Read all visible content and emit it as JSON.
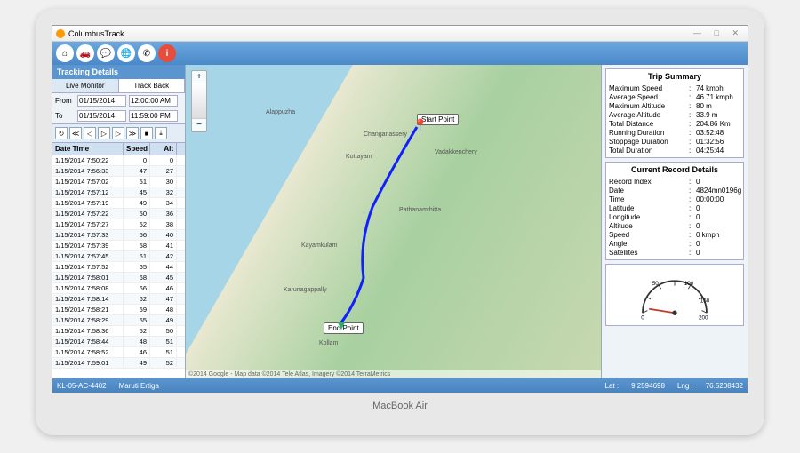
{
  "window": {
    "title": "ColumbusTrack"
  },
  "toolbar_icons": [
    "home-icon",
    "car-icon",
    "chat-icon",
    "globe-icon",
    "phone-icon",
    "info-icon"
  ],
  "left": {
    "header": "Tracking Details",
    "tabs": [
      "Live Monitor",
      "Track Back"
    ],
    "from_label": "From",
    "to_label": "To",
    "from_date": "01/15/2014",
    "from_time": "12:00:00 AM",
    "to_date": "01/15/2014",
    "to_time": "11:59:00 PM",
    "columns": [
      "Date Time",
      "Speed",
      "Alt"
    ],
    "rows": [
      {
        "dt": "1/15/2014 7:50:22",
        "sp": "0",
        "al": "0"
      },
      {
        "dt": "1/15/2014 7:56:33",
        "sp": "47",
        "al": "27"
      },
      {
        "dt": "1/15/2014 7:57:02",
        "sp": "51",
        "al": "30"
      },
      {
        "dt": "1/15/2014 7:57:12",
        "sp": "45",
        "al": "32"
      },
      {
        "dt": "1/15/2014 7:57:19",
        "sp": "49",
        "al": "34"
      },
      {
        "dt": "1/15/2014 7:57:22",
        "sp": "50",
        "al": "36"
      },
      {
        "dt": "1/15/2014 7:57:27",
        "sp": "52",
        "al": "38"
      },
      {
        "dt": "1/15/2014 7:57:33",
        "sp": "56",
        "al": "40"
      },
      {
        "dt": "1/15/2014 7:57:39",
        "sp": "58",
        "al": "41"
      },
      {
        "dt": "1/15/2014 7:57:45",
        "sp": "61",
        "al": "42"
      },
      {
        "dt": "1/15/2014 7:57:52",
        "sp": "65",
        "al": "44"
      },
      {
        "dt": "1/15/2014 7:58:01",
        "sp": "68",
        "al": "45"
      },
      {
        "dt": "1/15/2014 7:58:08",
        "sp": "66",
        "al": "46"
      },
      {
        "dt": "1/15/2014 7:58:14",
        "sp": "62",
        "al": "47"
      },
      {
        "dt": "1/15/2014 7:58:21",
        "sp": "59",
        "al": "48"
      },
      {
        "dt": "1/15/2014 7:58:29",
        "sp": "55",
        "al": "49"
      },
      {
        "dt": "1/15/2014 7:58:36",
        "sp": "52",
        "al": "50"
      },
      {
        "dt": "1/15/2014 7:58:44",
        "sp": "48",
        "al": "51"
      },
      {
        "dt": "1/15/2014 7:58:52",
        "sp": "46",
        "al": "51"
      },
      {
        "dt": "1/15/2014 7:59:01",
        "sp": "49",
        "al": "52"
      }
    ]
  },
  "map": {
    "start_label": "Start Point",
    "end_label": "End Point",
    "cities": [
      "Alappuzha",
      "Kottayam",
      "Changanassery",
      "Pathanamthitta",
      "Kollam",
      "Karunagappally",
      "Kayamkulam",
      "Vadakkenchery"
    ],
    "attribution": "©2014 Google - Map data ©2014 Tele Atlas, Imagery ©2014 TerraMetrics"
  },
  "summary": {
    "title": "Trip Summary",
    "rows": [
      {
        "k": "Maximum Speed",
        "v": "74 kmph"
      },
      {
        "k": "Average Speed",
        "v": "46.71 kmph"
      },
      {
        "k": "Maximum Altitude",
        "v": "80 m"
      },
      {
        "k": "Average Altitude",
        "v": "33.9 m"
      },
      {
        "k": "Total Distance",
        "v": "204.86 Km"
      },
      {
        "k": "Running Duration",
        "v": "03:52:48"
      },
      {
        "k": "Stoppage Duration",
        "v": "01:32:56"
      },
      {
        "k": "Total Duration",
        "v": "04:25:44"
      }
    ]
  },
  "record": {
    "title": "Current Record Details",
    "rows": [
      {
        "k": "Record Index",
        "v": "0"
      },
      {
        "k": "Date",
        "v": "4824mn0196g"
      },
      {
        "k": "Time",
        "v": "00:00:00"
      },
      {
        "k": "Latitude",
        "v": "0"
      },
      {
        "k": "Longitude",
        "v": "0"
      },
      {
        "k": "Altitude",
        "v": "0"
      },
      {
        "k": "Speed",
        "v": "0 kmph"
      },
      {
        "k": "Angle",
        "v": "0"
      },
      {
        "k": "Satellites",
        "v": "0"
      }
    ]
  },
  "gauge": {
    "min": "0",
    "t1": "50",
    "t2": "100",
    "t3": "150",
    "max": "200"
  },
  "status": {
    "device": "KL-05-AC-4402",
    "vehicle": "Maruti Ertiga",
    "lat_label": "Lat :",
    "lat": "9.2594698",
    "lng_label": "Lng :",
    "lng": "76.5208432"
  }
}
